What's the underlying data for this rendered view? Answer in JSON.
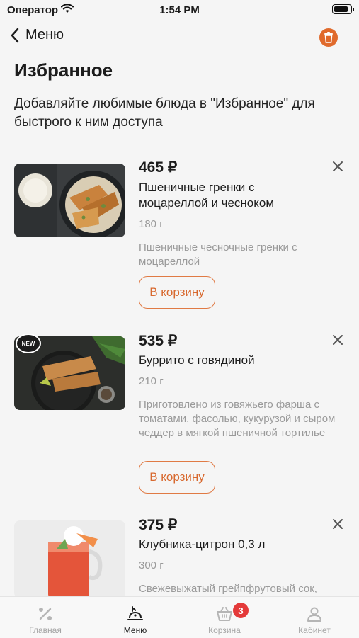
{
  "status_bar": {
    "carrier": "Оператор",
    "time": "1:54 PM"
  },
  "nav": {
    "back_label": "Меню"
  },
  "page": {
    "title": "Избранное",
    "subtitle": "Добавляйте любимые блюда в \"Избранное\" для быстрого к ним доступа"
  },
  "items": [
    {
      "price": "465 ₽",
      "name": "Пшеничные гренки с моцареллой и чесноком",
      "weight": "180 г",
      "description": "Пшеничные чесночные гренки с моцареллой",
      "button": "В корзину"
    },
    {
      "price": "535 ₽",
      "name": "Буррито с говядиной",
      "weight": "210 г",
      "description": "Приготовлено из говяжьего фарша с томатами, фасолью, кукурузой и сыром чеддер в мягкой пшеничной тортилье",
      "button": "В корзину",
      "badge": "NEW"
    },
    {
      "price": "375 ₽",
      "name": "Клубника-цитрон 0,3 л",
      "weight": "300 г",
      "description": "Свежевыжатый грейпфрутовый сок,"
    }
  ],
  "tabbar": {
    "tabs": [
      {
        "label": "Главная",
        "icon": "percent-icon"
      },
      {
        "label": "Меню",
        "icon": "menu-dish-icon"
      },
      {
        "label": "Корзина",
        "icon": "basket-icon",
        "badge": "3"
      },
      {
        "label": "Кабинет",
        "icon": "person-icon"
      }
    ]
  },
  "colors": {
    "accent": "#e06a2c",
    "badge": "#e43a3a",
    "muted": "#9a9a9a"
  }
}
